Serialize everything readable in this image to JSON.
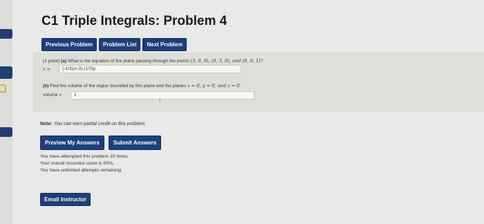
{
  "title": "C1 Triple Integrals: Problem 4",
  "nav": {
    "previous": "Previous Problem",
    "list": "Problem List",
    "next": "Next Problem"
  },
  "problem": {
    "part_a_prefix": "(1 point)",
    "part_a_label": "(a)",
    "part_a_text": "What is the equation of the plane passing through the points",
    "points": "(3, 0, 0), (0, 3, 0), and (0, 0, 1)?",
    "z_label": "z =",
    "z_answer": "(-1/3)(x-3)-(1/3)y",
    "part_b_label": "(b)",
    "part_b_text": "Find the volume of the region bounded by this plane and the planes",
    "planes": "x = 0, y = 0, and z = 0.",
    "volume_label": "volume =",
    "volume_answer": "1"
  },
  "note": {
    "label": "Note:",
    "text": "You can earn partial credit on this problem."
  },
  "actions": {
    "preview": "Preview My Answers",
    "submit": "Submit Answers"
  },
  "status": {
    "attempts": "You have attempted this problem 10 times.",
    "score": "Your overall recorded score is 50%.",
    "remaining": "You have unlimited attempts remaining."
  },
  "email_button": "Email instructor"
}
